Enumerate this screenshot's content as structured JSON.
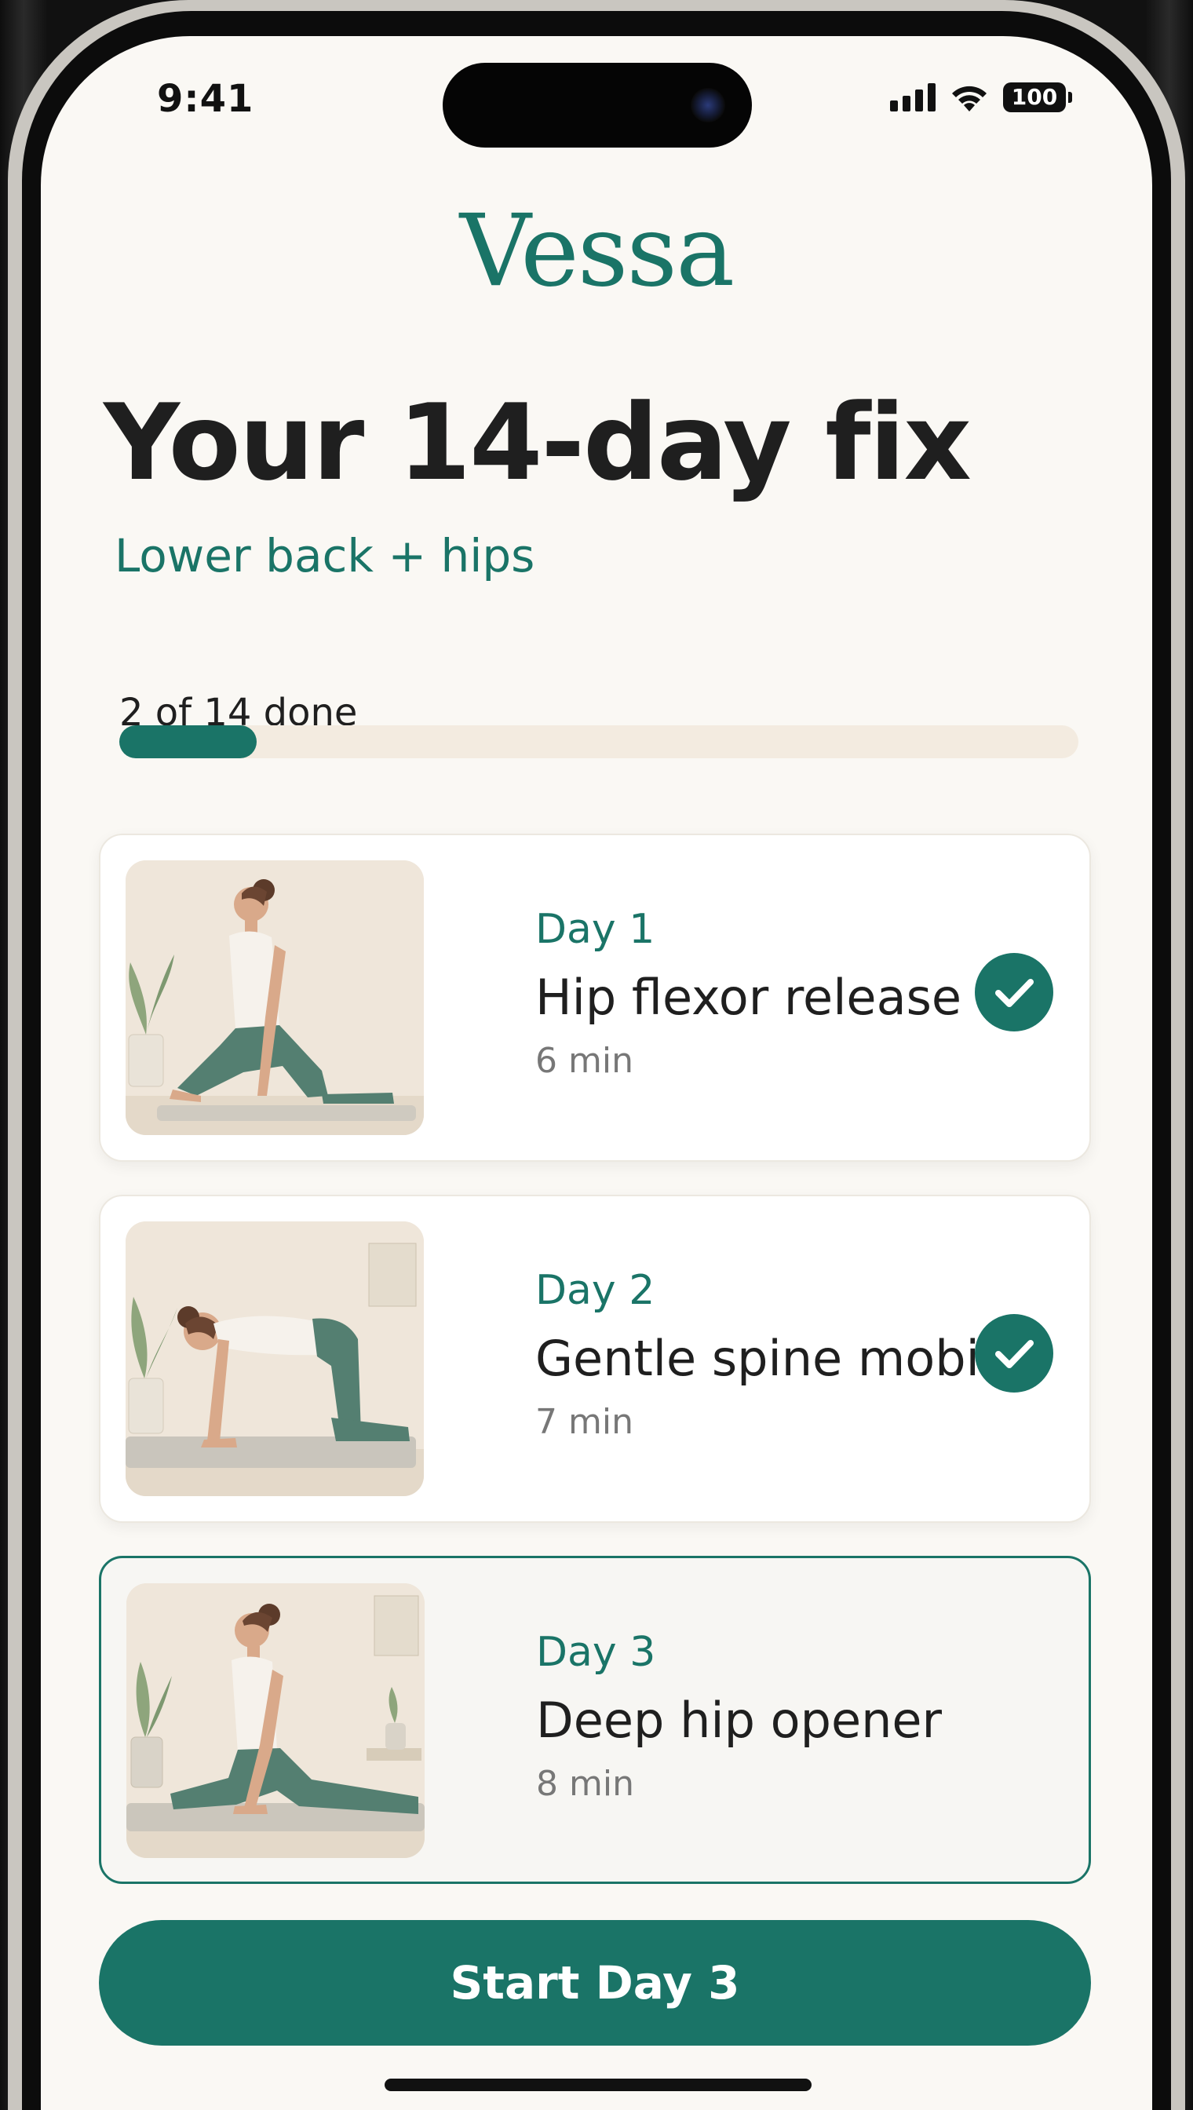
{
  "status_bar": {
    "time": "9:41",
    "battery": "100",
    "icons": [
      "signal-icon",
      "wifi-icon",
      "battery-icon"
    ]
  },
  "app": {
    "logo": "Vessa"
  },
  "header": {
    "title": "Your 14-day fix",
    "subtitle": "Lower back + hips"
  },
  "progress": {
    "label": "2 of 14 done",
    "completed": 2,
    "total": 14
  },
  "days": [
    {
      "day": "Day 1",
      "title": "Hip flexor release",
      "duration": "6 min",
      "completed": true,
      "image": "woman-low-lunge-illustration"
    },
    {
      "day": "Day 2",
      "title": "Gentle spine mobility",
      "duration": "7 min",
      "completed": true,
      "image": "woman-tabletop-pose-illustration"
    },
    {
      "day": "Day 3",
      "title": "Deep hip opener",
      "duration": "8 min",
      "completed": false,
      "current": true,
      "image": "woman-pigeon-pose-illustration"
    }
  ],
  "cta": {
    "label": "Start Day 3"
  },
  "colors": {
    "accent": "#1a7467",
    "background": "#faf8f4",
    "track": "#f3ebe0",
    "text": "#1f1f1f",
    "muted": "#777777"
  }
}
